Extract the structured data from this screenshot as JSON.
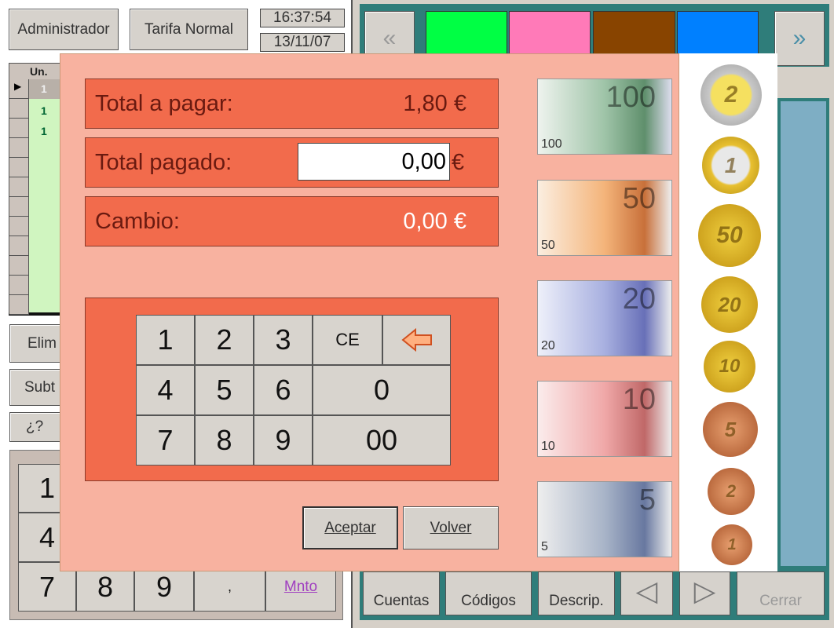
{
  "header": {
    "user": "Administrador",
    "tariff": "Tarifa Normal",
    "time": "16:37:54",
    "date": "13/11/07"
  },
  "grid": {
    "column": "Un.",
    "rows": [
      "1",
      "1",
      "1"
    ]
  },
  "left_buttons": [
    "Elim",
    "Subt",
    "¿?"
  ],
  "left_keypad": [
    "1",
    "4",
    "7",
    "8",
    "9",
    ",",
    "Mnto"
  ],
  "category_colors": [
    "#00ff44",
    "#ff7ab8",
    "#884400",
    "#0080ff"
  ],
  "nav": {
    "prev": "«",
    "next": "»"
  },
  "dialog": {
    "total_label": "Total a pagar:",
    "total_value": "1,80 €",
    "paid_label": "Total pagado:",
    "paid_value": "0,00",
    "paid_currency": "€",
    "change_label": "Cambio:",
    "change_value": "0,00 €",
    "keys": [
      "1",
      "2",
      "3",
      "CE",
      "4",
      "5",
      "6",
      "0",
      "7",
      "8",
      "9",
      "00"
    ],
    "accept": "Aceptar",
    "back": "Volver",
    "bills": [
      "100",
      "50",
      "20",
      "10",
      "5"
    ],
    "coins": [
      "2",
      "1",
      "50",
      "20",
      "10",
      "5",
      "2",
      "1"
    ]
  },
  "toolbar": [
    "Cuentas",
    "Códigos",
    "Descrip.",
    "◁",
    "▷",
    "Cerrar"
  ]
}
